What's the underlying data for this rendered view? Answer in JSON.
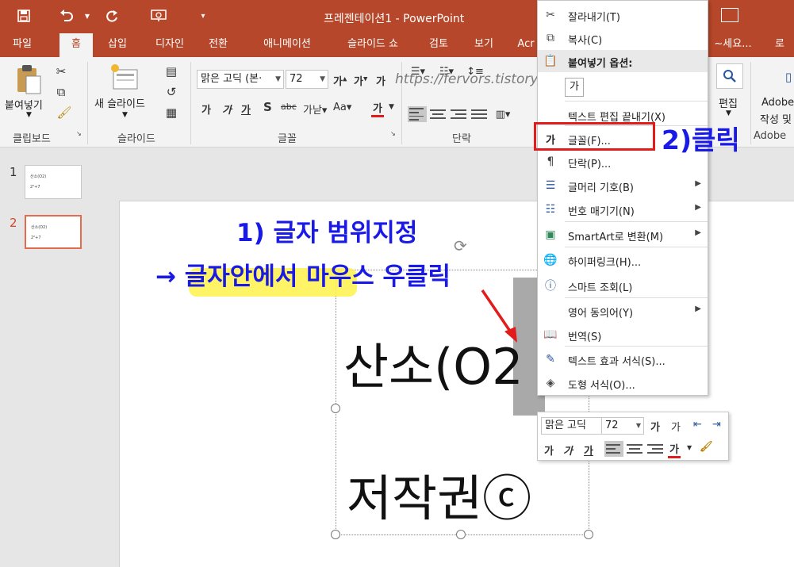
{
  "app": {
    "title": "프레젠테이션1 - PowerPoint",
    "colors": {
      "accent": "#b7472a",
      "annotation_blue": "#1a1ae6",
      "annotation_red": "#e21b1b",
      "highlight": "#fff24a"
    }
  },
  "qat": {
    "save_icon": "save-icon",
    "undo_icon": "undo-icon",
    "redo_icon": "redo-icon",
    "present_icon": "present-icon",
    "customize_icon": "customize-icon"
  },
  "tabs": [
    "파일",
    "홈",
    "삽입",
    "디자인",
    "전환",
    "애니메이션",
    "슬라이드 쇼",
    "검토",
    "보기",
    "Acr"
  ],
  "tabs_right": {
    "tell_me": "~세요...",
    "login": "로"
  },
  "ribbon": {
    "clipboard": {
      "paste": "붙여넣기",
      "group": "클립보드"
    },
    "slides": {
      "new_slide": "새 슬라이드",
      "group": "슬라이드"
    },
    "font": {
      "name": "맑은 고딕 (본·",
      "size": "72",
      "group": "글꼴"
    },
    "paragraph": {
      "group": "단락"
    },
    "editing": {
      "label": "편집"
    },
    "adobe": {
      "line1": "Adobe",
      "line2": "작성 및",
      "group": "Adobe"
    }
  },
  "watermark": "https://fervors.tistory.com",
  "slides": [
    {
      "num": "1",
      "line1": "산소(O2)",
      "line2": "2²+7"
    },
    {
      "num": "2",
      "line1": "산소(O2)",
      "line2": "2²+7"
    }
  ],
  "slide_text": {
    "line1": "산소(O2",
    "line2": "저작권ⓒ"
  },
  "context_menu": {
    "items": [
      {
        "label": "잘라내기(T)",
        "icon": "scissors-icon"
      },
      {
        "label": "복사(C)",
        "icon": "copy-icon"
      },
      {
        "label": "붙여넣기 옵션:",
        "icon": "paste-icon"
      },
      {
        "label": "",
        "icon": "paste-text-only-icon"
      },
      {
        "label": "텍스트 편집 끝내기(X)",
        "icon": ""
      },
      {
        "label": "글꼴(F)...",
        "icon": "font-icon"
      },
      {
        "label": "단락(P)...",
        "icon": "paragraph-icon"
      },
      {
        "label": "글머리 기호(B)",
        "icon": "bullets-icon"
      },
      {
        "label": "번호 매기기(N)",
        "icon": "numbering-icon"
      },
      {
        "label": "SmartArt로 변환(M)",
        "icon": "smartart-icon"
      },
      {
        "label": "하이퍼링크(H)...",
        "icon": "hyperlink-icon"
      },
      {
        "label": "스마트 조회(L)",
        "icon": "smart-lookup-icon"
      },
      {
        "label": "영어 동의어(Y)",
        "icon": ""
      },
      {
        "label": "번역(S)",
        "icon": "translate-icon"
      },
      {
        "label": "텍스트 효과 서식(S)...",
        "icon": "text-effects-icon"
      },
      {
        "label": "도형 서식(O)...",
        "icon": "shape-format-icon"
      }
    ],
    "paste_glyph": "가",
    "font_glyph": "가"
  },
  "mini_toolbar": {
    "font": "맑은 고딕",
    "size": "72"
  },
  "annotations": {
    "step1_line1": "1) 글자 범위지정",
    "step1_line2": "→ 글자안에서 마우스 우클릭",
    "step2": "2)클릭"
  }
}
